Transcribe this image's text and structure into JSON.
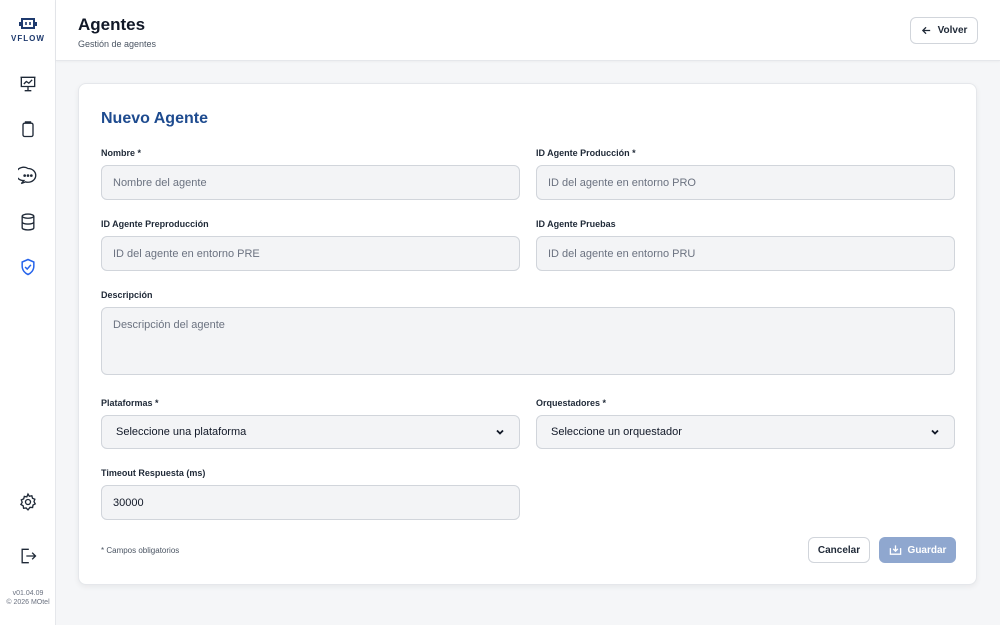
{
  "sidebar": {
    "logo_text": "VFLOW",
    "nav_items": [
      {
        "icon": "presentation-chart-icon"
      },
      {
        "icon": "clipboard-icon"
      },
      {
        "icon": "chat-bubble-icon"
      },
      {
        "icon": "database-icon"
      },
      {
        "icon": "shield-check-icon",
        "active": true
      }
    ],
    "bottom_items": [
      {
        "icon": "gear-icon"
      },
      {
        "icon": "logout-icon"
      }
    ],
    "version": "v01.04.09",
    "copyright": "© 2026 MOtel"
  },
  "header": {
    "title": "Agentes",
    "subtitle": "Gestión de agentes",
    "back_label": "Volver"
  },
  "form": {
    "title": "Nuevo Agente",
    "nombre": {
      "label": "Nombre *",
      "placeholder": "Nombre del agente",
      "value": ""
    },
    "id_pro": {
      "label": "ID Agente Producción *",
      "placeholder": "ID del agente en entorno PRO",
      "value": ""
    },
    "id_pre": {
      "label": "ID Agente Preproducción",
      "placeholder": "ID del agente en entorno PRE",
      "value": ""
    },
    "id_pru": {
      "label": "ID Agente Pruebas",
      "placeholder": "ID del agente en entorno PRU",
      "value": ""
    },
    "descripcion": {
      "label": "Descripción",
      "placeholder": "Descripción del agente",
      "value": ""
    },
    "plataformas": {
      "label": "Plataformas *",
      "selected": "Seleccione una plataforma"
    },
    "orquestadores": {
      "label": "Orquestadores *",
      "selected": "Seleccione un orquestador"
    },
    "timeout": {
      "label": "Timeout Respuesta (ms)",
      "value": "30000"
    },
    "required_note": "* Campos obligatorios",
    "cancel_label": "Cancelar",
    "save_label": "Guardar"
  },
  "colors": {
    "accent": "#1e4b8f",
    "save_disabled": "#8fa7cf",
    "active_nav": "#2563eb"
  }
}
